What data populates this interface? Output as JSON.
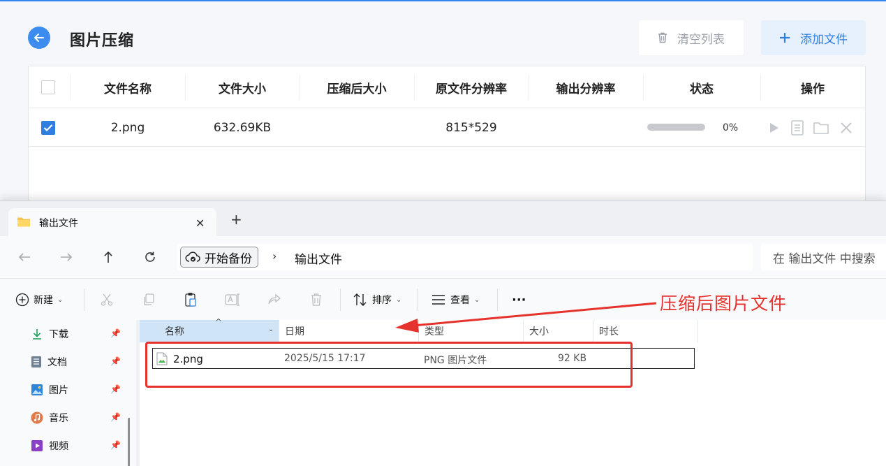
{
  "app": {
    "title": "图片压缩",
    "clear_button": "清空列表",
    "add_button": "添加文件",
    "accent": "#2f7fe0",
    "columns": [
      "文件名称",
      "文件大小",
      "压缩后大小",
      "原文件分辨率",
      "输出分辨率",
      "状态",
      "操作"
    ],
    "rows": [
      {
        "checked": true,
        "name": "2.png",
        "size": "632.69KB",
        "compressed_size": "",
        "orig_resolution": "815*529",
        "out_resolution": "",
        "progress": 0,
        "progress_text": "0%"
      }
    ]
  },
  "explorer": {
    "tab_title": "输出文件",
    "address": {
      "crumb": "开始备份",
      "path": "输出文件"
    },
    "search_placeholder": "在 输出文件 中搜索",
    "toolbar": {
      "new": "新建",
      "sort": "排序",
      "view": "查看",
      "more": "···"
    },
    "sidebar": [
      {
        "label": "下载",
        "icon": "download-icon"
      },
      {
        "label": "文档",
        "icon": "document-icon"
      },
      {
        "label": "图片",
        "icon": "picture-icon"
      },
      {
        "label": "音乐",
        "icon": "music-icon"
      },
      {
        "label": "视频",
        "icon": "video-icon"
      }
    ],
    "columns": {
      "name": "名称",
      "date": "日期",
      "type": "类型",
      "size": "大小",
      "duration": "时长"
    },
    "files": [
      {
        "name": "2.png",
        "date": "2025/5/15 17:17",
        "type": "PNG 图片文件",
        "size": "92 KB"
      }
    ]
  },
  "annotation": {
    "text": "压缩后图片文件",
    "color": "#e5322d"
  }
}
